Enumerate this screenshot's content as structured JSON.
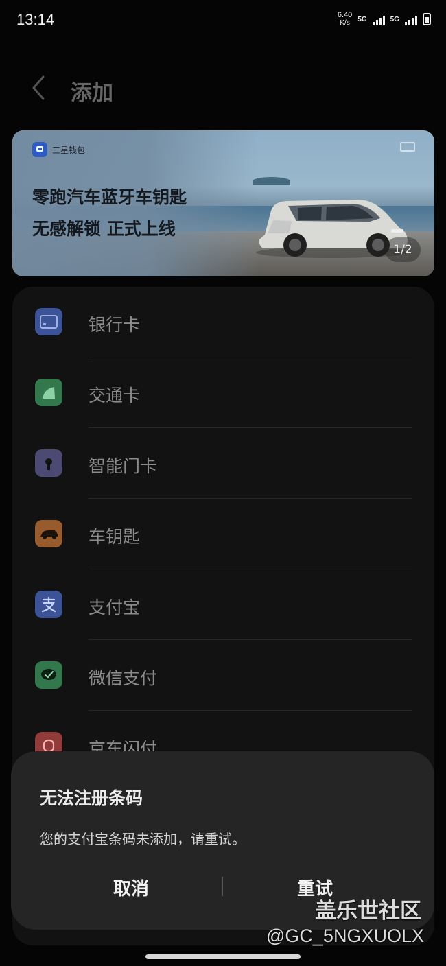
{
  "status_bar": {
    "time": "13:14",
    "network_speed": "6.40",
    "network_unit": "K/s",
    "network_a": "5G",
    "network_b": "5G"
  },
  "header": {
    "title": "添加"
  },
  "banner": {
    "brand": "三星钱包",
    "line1": "零跑汽车蓝牙车钥匙",
    "line2": "无感解锁 正式上线",
    "pager": "1/2"
  },
  "list": [
    {
      "label": "银行卡",
      "icon": "bank-card-icon",
      "color": "#3c5497"
    },
    {
      "label": "交通卡",
      "icon": "transit-card-icon",
      "color": "#33784d"
    },
    {
      "label": "智能门卡",
      "icon": "door-card-icon",
      "color": "#4c4a73"
    },
    {
      "label": "车钥匙",
      "icon": "car-key-icon",
      "color": "#985b2e"
    },
    {
      "label": "支付宝",
      "icon": "alipay-icon",
      "color": "#3c5497"
    },
    {
      "label": "微信支付",
      "icon": "wechat-pay-icon",
      "color": "#33784d"
    },
    {
      "label": "京东闪付",
      "icon": "jd-pay-icon",
      "color": "#913b3b"
    }
  ],
  "dialog": {
    "title": "无法注册条码",
    "message": "您的支付宝条码未添加，请重试。",
    "cancel": "取消",
    "retry": "重试"
  },
  "watermark": {
    "line1": "盖乐世社区",
    "line2": "@GC_5NGXUOLX"
  }
}
